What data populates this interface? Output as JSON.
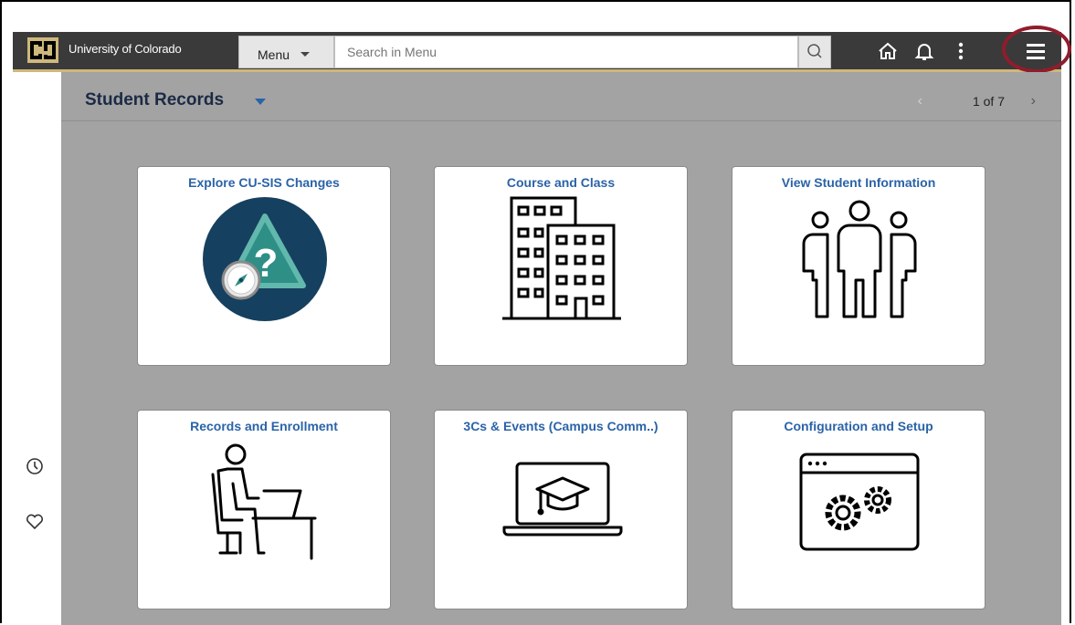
{
  "header": {
    "university": "University of Colorado",
    "menu_label": "Menu",
    "search_placeholder": "Search in Menu"
  },
  "page": {
    "title": "Student Records",
    "pager": "1 of 7"
  },
  "tiles": [
    {
      "title": "Explore CU-SIS Changes",
      "icon": "compass-question-icon"
    },
    {
      "title": "Course and Class",
      "icon": "buildings-icon"
    },
    {
      "title": "View Student Information",
      "icon": "people-group-icon"
    },
    {
      "title": "Records and Enrollment",
      "icon": "person-at-desk-icon"
    },
    {
      "title": "3Cs & Events (Campus Comm..)",
      "icon": "laptop-graduation-cap-icon"
    },
    {
      "title": "Configuration and Setup",
      "icon": "window-gears-icon"
    }
  ],
  "colors": {
    "topbar": "#3a3a3a",
    "accent_gold": "#cfb87c",
    "tile_title": "#2a63a8",
    "highlight_circle": "#8f1d2c",
    "content_bg": "#a3a3a3"
  }
}
